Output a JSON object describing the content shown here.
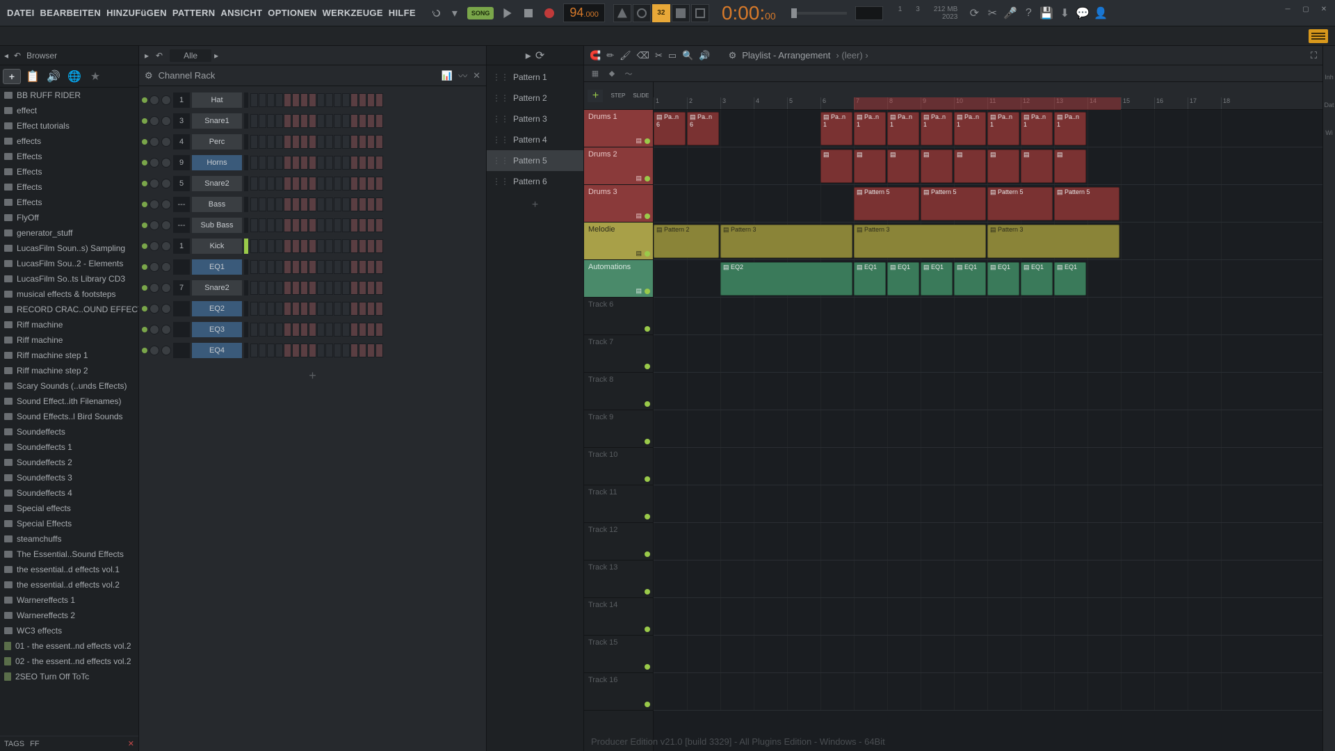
{
  "menu": {
    "items": [
      "DATEI",
      "BEARBEITEN",
      "HINZUFüGEN",
      "PATTERN",
      "ANSICHT",
      "OPTIONEN",
      "WERKZEUGE",
      "HILFE"
    ]
  },
  "transport": {
    "song_label": "SONG",
    "tempo_int": "94",
    "tempo_dec": ".000",
    "time_main": "0:00:",
    "time_sub": "00",
    "orange_badge": "32"
  },
  "info": {
    "num1": "1",
    "num2": "3",
    "mem": "212 MB",
    "year": "2023"
  },
  "browser": {
    "title": "Browser",
    "filter": "Alle",
    "tags_label": "TAGS",
    "tag1": "FF",
    "items": [
      {
        "t": "folder",
        "n": "BB RUFF RIDER"
      },
      {
        "t": "folder",
        "n": "effect"
      },
      {
        "t": "folder",
        "n": "Effect tutorials"
      },
      {
        "t": "folder",
        "n": "effects"
      },
      {
        "t": "folder",
        "n": "Effects"
      },
      {
        "t": "folder",
        "n": "Effects"
      },
      {
        "t": "folder",
        "n": "Effects"
      },
      {
        "t": "folder",
        "n": "Effects"
      },
      {
        "t": "folder",
        "n": "FlyOff"
      },
      {
        "t": "folder",
        "n": "generator_stuff"
      },
      {
        "t": "folder",
        "n": "LucasFilm Soun..s) Sampling"
      },
      {
        "t": "folder",
        "n": "LucasFilm Sou..2 - Elements"
      },
      {
        "t": "folder",
        "n": "LucasFilm So..ts Library CD3"
      },
      {
        "t": "folder",
        "n": "musical effects & footsteps"
      },
      {
        "t": "folder",
        "n": "RECORD CRAC..OUND EFFECT"
      },
      {
        "t": "folder",
        "n": "Riff machine"
      },
      {
        "t": "folder",
        "n": "Riff machine"
      },
      {
        "t": "folder",
        "n": "Riff machine step 1"
      },
      {
        "t": "folder",
        "n": "Riff machine step 2"
      },
      {
        "t": "folder",
        "n": "Scary Sounds (..unds Effects)"
      },
      {
        "t": "folder",
        "n": "Sound Effect..ith Filenames)"
      },
      {
        "t": "folder",
        "n": "Sound Effects..l Bird Sounds"
      },
      {
        "t": "folder",
        "n": "Soundeffects"
      },
      {
        "t": "folder",
        "n": "Soundeffects 1"
      },
      {
        "t": "folder",
        "n": "Soundeffects 2"
      },
      {
        "t": "folder",
        "n": "Soundeffects 3"
      },
      {
        "t": "folder",
        "n": "Soundeffects 4"
      },
      {
        "t": "folder",
        "n": "Special effects"
      },
      {
        "t": "folder",
        "n": "Special Effects"
      },
      {
        "t": "folder",
        "n": "steamchuffs"
      },
      {
        "t": "folder",
        "n": "The Essential..Sound Effects"
      },
      {
        "t": "folder",
        "n": "the essential..d effects vol.1"
      },
      {
        "t": "folder",
        "n": "the essential..d effects vol.2"
      },
      {
        "t": "folder",
        "n": "Warnereffects 1"
      },
      {
        "t": "folder",
        "n": "Warnereffects 2"
      },
      {
        "t": "folder",
        "n": "WC3 effects"
      },
      {
        "t": "file",
        "n": "01 - the essent..nd effects vol.2"
      },
      {
        "t": "file",
        "n": "02 - the essent..nd effects vol.2"
      },
      {
        "t": "file",
        "n": "2SEO Turn Off ToTc"
      }
    ]
  },
  "channel_rack": {
    "title": "Channel Rack",
    "channels": [
      {
        "num": "1",
        "name": "Hat",
        "blue": false,
        "sel": false
      },
      {
        "num": "3",
        "name": "Snare1",
        "blue": false,
        "sel": false
      },
      {
        "num": "4",
        "name": "Perc",
        "blue": false,
        "sel": false
      },
      {
        "num": "9",
        "name": "Horns",
        "blue": true,
        "sel": false
      },
      {
        "num": "5",
        "name": "Snare2",
        "blue": false,
        "sel": false
      },
      {
        "num": "---",
        "name": "Bass",
        "blue": false,
        "sel": false
      },
      {
        "num": "---",
        "name": "Sub Bass",
        "blue": false,
        "sel": false
      },
      {
        "num": "1",
        "name": "Kick",
        "blue": false,
        "sel": true
      },
      {
        "num": "",
        "name": "EQ1",
        "blue": true,
        "sel": false
      },
      {
        "num": "7",
        "name": "Snare2",
        "blue": false,
        "sel": false
      },
      {
        "num": "",
        "name": "EQ2",
        "blue": true,
        "sel": false
      },
      {
        "num": "",
        "name": "EQ3",
        "blue": true,
        "sel": false
      },
      {
        "num": "",
        "name": "EQ4",
        "blue": true,
        "sel": false
      }
    ],
    "add": "+"
  },
  "patterns": {
    "items": [
      "Pattern 1",
      "Pattern 2",
      "Pattern 3",
      "Pattern 4",
      "Pattern 5",
      "Pattern 6"
    ],
    "selected": 4,
    "add": "+"
  },
  "playlist": {
    "title": "Playlist - Arrangement",
    "crumb": "(leer)",
    "step_label": "STEP",
    "slide_label": "SLIDE",
    "add_btn": "+",
    "ruler": [
      "1",
      "2",
      "3",
      "4",
      "5",
      "6",
      "7",
      "8",
      "9",
      "10",
      "11",
      "12",
      "13",
      "14",
      "15",
      "16",
      "17",
      "18"
    ],
    "loop_start": 6,
    "loop_end": 14,
    "tracks": [
      {
        "name": "Drums 1",
        "color": "red"
      },
      {
        "name": "Drums 2",
        "color": "red"
      },
      {
        "name": "Drums 3",
        "color": "red"
      },
      {
        "name": "Melodie",
        "color": "yellow"
      },
      {
        "name": "Automations",
        "color": "green"
      },
      {
        "name": "Track 6",
        "color": "empty"
      },
      {
        "name": "Track 7",
        "color": "empty"
      },
      {
        "name": "Track 8",
        "color": "empty"
      },
      {
        "name": "Track 9",
        "color": "empty"
      },
      {
        "name": "Track 10",
        "color": "empty"
      },
      {
        "name": "Track 11",
        "color": "empty"
      },
      {
        "name": "Track 12",
        "color": "empty"
      },
      {
        "name": "Track 13",
        "color": "empty"
      },
      {
        "name": "Track 14",
        "color": "empty"
      },
      {
        "name": "Track 15",
        "color": "empty"
      },
      {
        "name": "Track 16",
        "color": "empty"
      }
    ],
    "clips": [
      {
        "track": 0,
        "start": 1,
        "len": 1,
        "label": "Pa..n 6",
        "color": "red"
      },
      {
        "track": 0,
        "start": 2,
        "len": 1,
        "label": "Pa..n 6",
        "color": "red"
      },
      {
        "track": 0,
        "start": 6,
        "len": 1,
        "label": "Pa..n 1",
        "color": "red"
      },
      {
        "track": 0,
        "start": 7,
        "len": 1,
        "label": "Pa..n 1",
        "color": "red"
      },
      {
        "track": 0,
        "start": 8,
        "len": 1,
        "label": "Pa..n 1",
        "color": "red"
      },
      {
        "track": 0,
        "start": 9,
        "len": 1,
        "label": "Pa..n 1",
        "color": "red"
      },
      {
        "track": 0,
        "start": 10,
        "len": 1,
        "label": "Pa..n 1",
        "color": "red"
      },
      {
        "track": 0,
        "start": 11,
        "len": 1,
        "label": "Pa..n 1",
        "color": "red"
      },
      {
        "track": 0,
        "start": 12,
        "len": 1,
        "label": "Pa..n 1",
        "color": "red"
      },
      {
        "track": 0,
        "start": 13,
        "len": 1,
        "label": "Pa..n 1",
        "color": "red"
      },
      {
        "track": 1,
        "start": 6,
        "len": 1,
        "label": "",
        "color": "red"
      },
      {
        "track": 1,
        "start": 7,
        "len": 1,
        "label": "",
        "color": "red"
      },
      {
        "track": 1,
        "start": 8,
        "len": 1,
        "label": "",
        "color": "red"
      },
      {
        "track": 1,
        "start": 9,
        "len": 1,
        "label": "",
        "color": "red"
      },
      {
        "track": 1,
        "start": 10,
        "len": 1,
        "label": "",
        "color": "red"
      },
      {
        "track": 1,
        "start": 11,
        "len": 1,
        "label": "",
        "color": "red"
      },
      {
        "track": 1,
        "start": 12,
        "len": 1,
        "label": "",
        "color": "red"
      },
      {
        "track": 1,
        "start": 13,
        "len": 1,
        "label": "",
        "color": "red"
      },
      {
        "track": 2,
        "start": 7,
        "len": 2,
        "label": "Pattern 5",
        "color": "red"
      },
      {
        "track": 2,
        "start": 9,
        "len": 2,
        "label": "Pattern 5",
        "color": "red"
      },
      {
        "track": 2,
        "start": 11,
        "len": 2,
        "label": "Pattern 5",
        "color": "red"
      },
      {
        "track": 2,
        "start": 13,
        "len": 2,
        "label": "Pattern 5",
        "color": "red"
      },
      {
        "track": 3,
        "start": 1,
        "len": 2,
        "label": "Pattern 2",
        "color": "yellow"
      },
      {
        "track": 3,
        "start": 3,
        "len": 4,
        "label": "Pattern 3",
        "color": "yellow"
      },
      {
        "track": 3,
        "start": 7,
        "len": 4,
        "label": "Pattern 3",
        "color": "yellow"
      },
      {
        "track": 3,
        "start": 11,
        "len": 4,
        "label": "Pattern 3",
        "color": "yellow"
      },
      {
        "track": 4,
        "start": 3,
        "len": 4,
        "label": "EQ2",
        "color": "green"
      },
      {
        "track": 4,
        "start": 7,
        "len": 1,
        "label": "EQ1",
        "color": "green"
      },
      {
        "track": 4,
        "start": 8,
        "len": 1,
        "label": "EQ1",
        "color": "green"
      },
      {
        "track": 4,
        "start": 9,
        "len": 1,
        "label": "EQ1",
        "color": "green"
      },
      {
        "track": 4,
        "start": 10,
        "len": 1,
        "label": "EQ1",
        "color": "green"
      },
      {
        "track": 4,
        "start": 11,
        "len": 1,
        "label": "EQ1",
        "color": "green"
      },
      {
        "track": 4,
        "start": 12,
        "len": 1,
        "label": "EQ1",
        "color": "green"
      },
      {
        "track": 4,
        "start": 13,
        "len": 1,
        "label": "EQ1",
        "color": "green"
      }
    ],
    "footer": "Producer Edition v21.0 [build 3329] - All Plugins Edition - Windows - 64Bit"
  }
}
